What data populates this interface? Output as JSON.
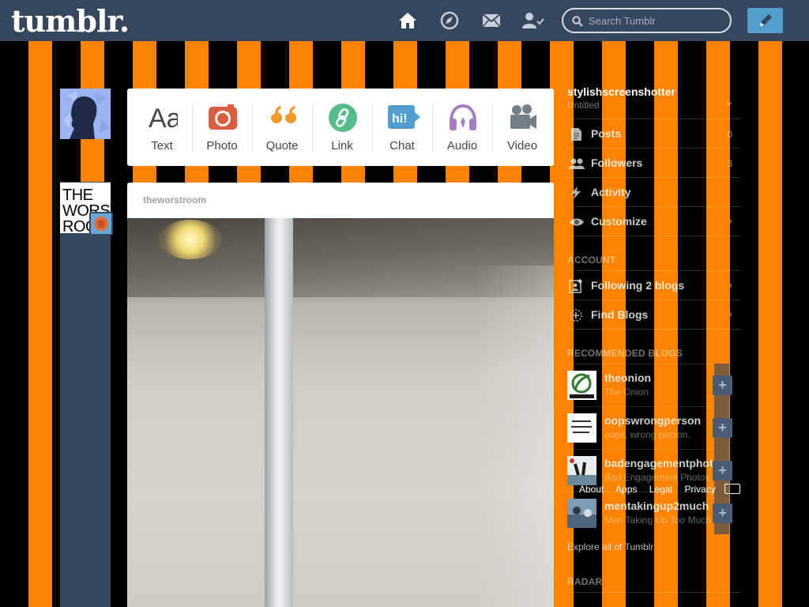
{
  "header": {
    "logo": "tumblr.",
    "search_placeholder": "Search Tumblr",
    "nav_icons": [
      "home-icon",
      "explore-icon",
      "mail-icon",
      "account-icon"
    ],
    "compose_icon": "pencil-icon"
  },
  "post_types": [
    {
      "label": "Text",
      "icon": "text-icon",
      "color": "#444444"
    },
    {
      "label": "Photo",
      "icon": "camera-icon",
      "color": "#d95e40"
    },
    {
      "label": "Quote",
      "icon": "quote-icon",
      "color": "#f2992e"
    },
    {
      "label": "Link",
      "icon": "link-icon",
      "color": "#56bc8a"
    },
    {
      "label": "Chat",
      "icon": "chat-icon",
      "color": "#529ecc"
    },
    {
      "label": "Audio",
      "icon": "audio-icon",
      "color": "#a77dc2"
    },
    {
      "label": "Video",
      "icon": "video-icon",
      "color": "#748089"
    }
  ],
  "left": {
    "worst_avatar_text": "THE\nWORST\nROOM"
  },
  "post": {
    "author": "theworstroom"
  },
  "sidebar": {
    "blog_name": "stylishscreenshotter",
    "blog_subtitle": "Untitled",
    "items": [
      {
        "label": "Posts",
        "count": "0",
        "icon": "posts-icon"
      },
      {
        "label": "Followers",
        "count": "3",
        "icon": "followers-icon"
      },
      {
        "label": "Activity",
        "count": "",
        "icon": "activity-icon"
      },
      {
        "label": "Customize",
        "count": "",
        "icon": "eye-icon"
      }
    ],
    "account_heading": "ACCOUNT",
    "account_items": [
      {
        "label": "Following 2 blogs",
        "icon": "following-icon"
      },
      {
        "label": "Find Blogs",
        "icon": "find-blogs-icon"
      }
    ],
    "recommended_heading": "RECOMMENDED BLOGS",
    "recommended": [
      {
        "name": "theonion",
        "desc": "The Onion"
      },
      {
        "name": "oopswrongperson",
        "desc": "oops, wrong person."
      },
      {
        "name": "badengagementphotos",
        "desc": "Bad Engagement Photos"
      },
      {
        "name": "mentakingup2much",
        "desc": "Men Taking Up Too Much"
      }
    ],
    "footer_links": [
      "About",
      "Apps",
      "Legal",
      "Privacy"
    ],
    "explore": "Explore all of Tumblr",
    "radar_heading": "RADAR"
  },
  "colors": {
    "header_bg": "#36465d",
    "stripe_orange": "#ff8300",
    "stripe_black": "#000000",
    "compose_bg": "#529ecc"
  }
}
